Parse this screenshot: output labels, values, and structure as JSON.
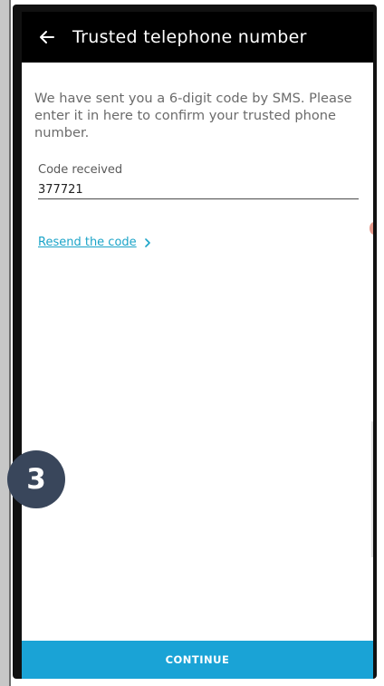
{
  "app_bar": {
    "back_icon": "arrow-left-icon",
    "title": "Trusted telephone number"
  },
  "content": {
    "intro_text": "We have sent you a 6-digit code by SMS. Please enter it in here to confirm your trusted phone number.",
    "code_field": {
      "label": "Code received",
      "value": "377721"
    },
    "resend_link": {
      "label": "Resend the code",
      "icon": "chevron-right-icon"
    }
  },
  "step_badge": "3",
  "continue_button": {
    "label": "CONTINUE"
  },
  "colors": {
    "app_bar": "#000000",
    "accent": "#1aa3d6",
    "link": "#1ba4c8",
    "badge": "#39465b"
  }
}
